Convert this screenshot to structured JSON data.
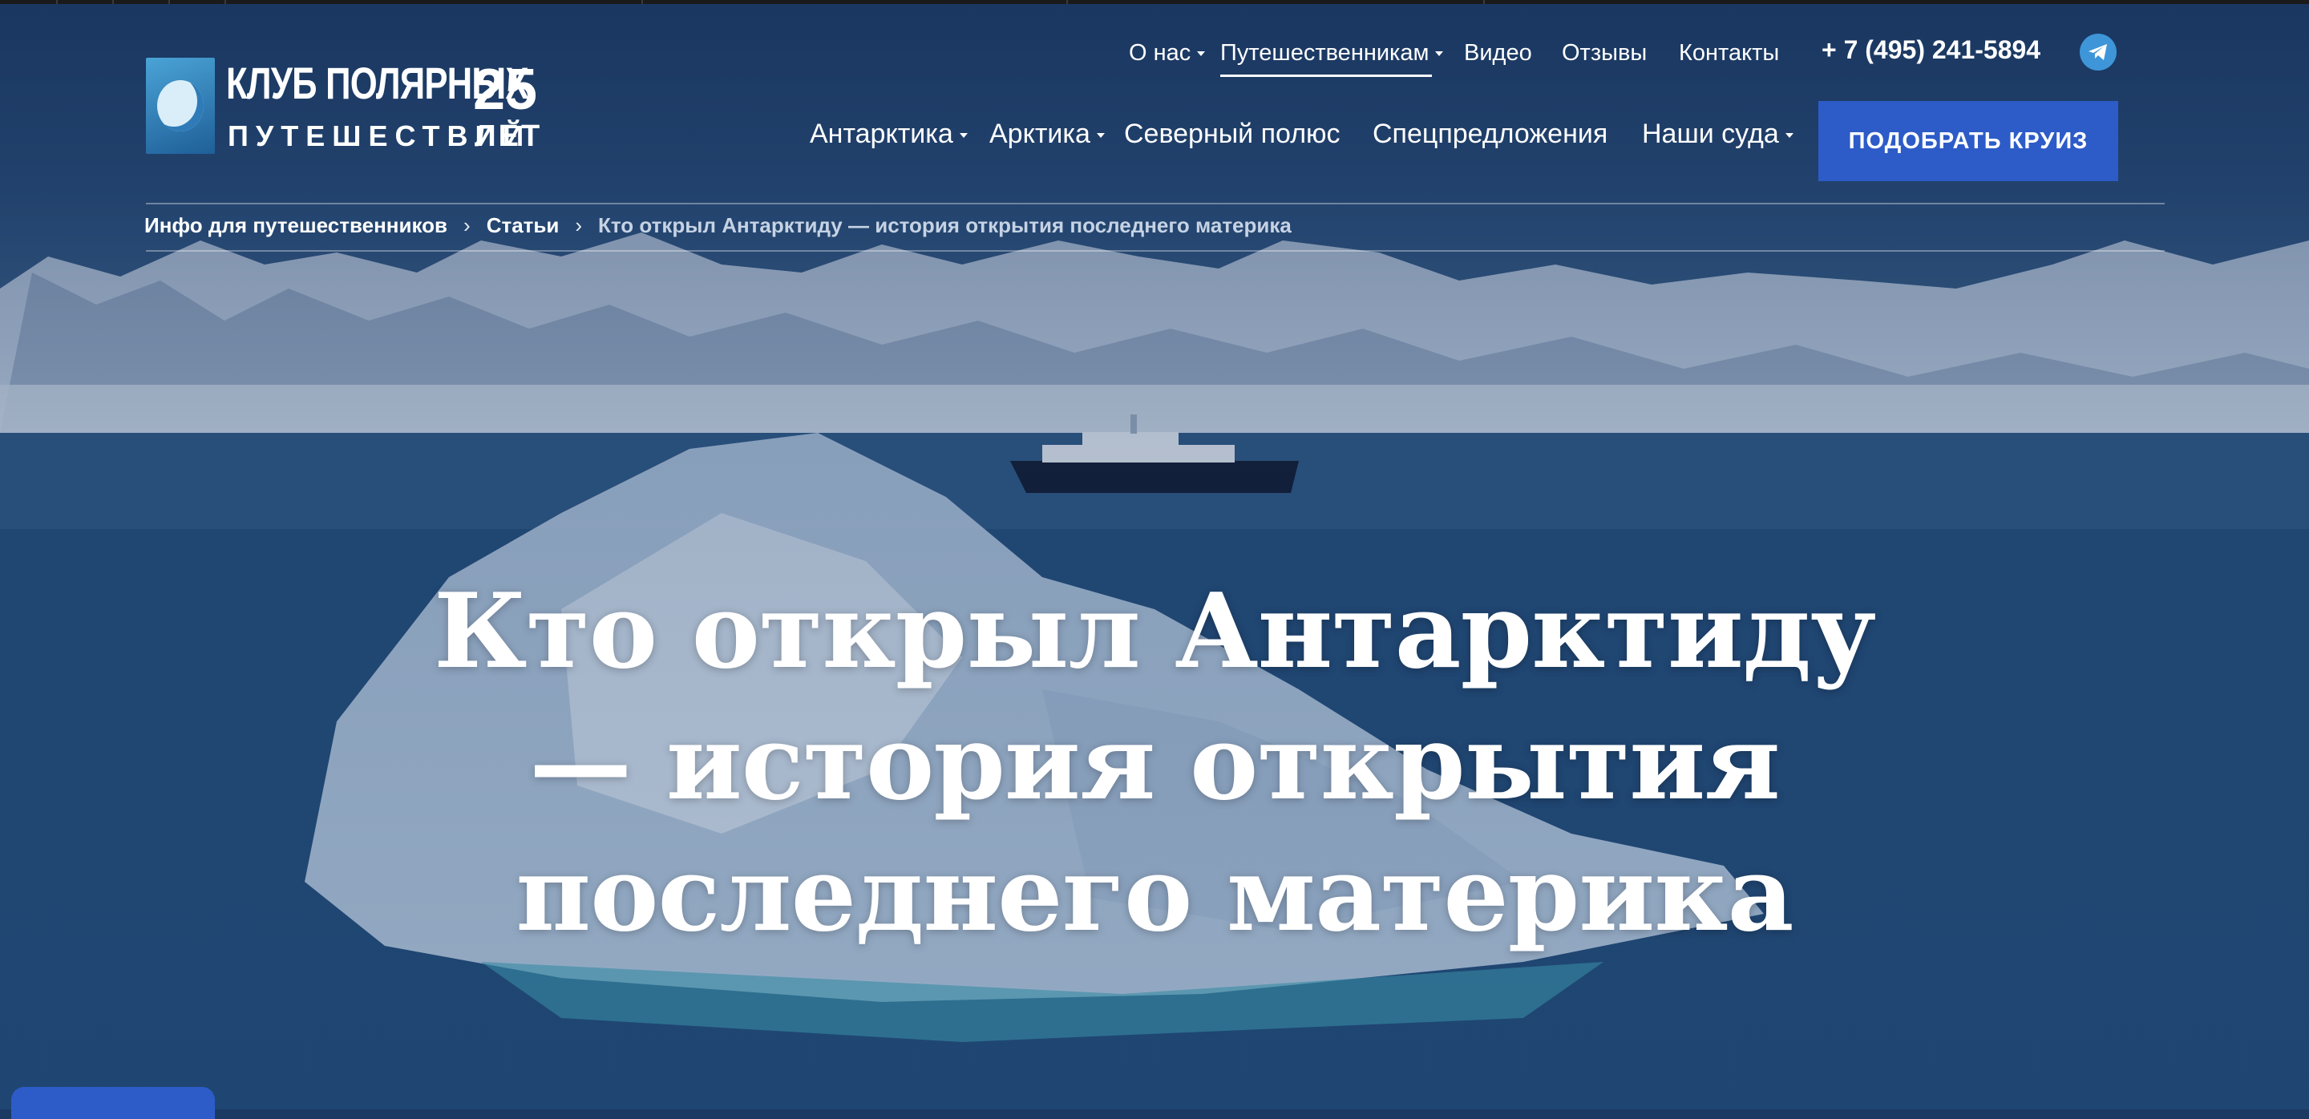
{
  "brand": {
    "logo_line1": "КЛУБ ПОЛЯРНЫХ",
    "logo_line2": "ПУТЕШЕСТВИЙ",
    "anniversary_number": "25",
    "anniversary_word": "ЛЕТ"
  },
  "nav_top": [
    {
      "label": "О нас",
      "dropdown": true
    },
    {
      "label": "Путешественникам",
      "dropdown": true,
      "active": true
    },
    {
      "label": "Видео",
      "dropdown": false
    },
    {
      "label": "Отзывы",
      "dropdown": false
    },
    {
      "label": "Контакты",
      "dropdown": false
    }
  ],
  "phone": "+ 7 (495) 241-5894",
  "telegram_icon": "telegram-icon",
  "nav_main": [
    {
      "label": "Антарктика",
      "dropdown": true
    },
    {
      "label": "Арктика",
      "dropdown": true
    },
    {
      "label": "Северный полюс",
      "dropdown": false
    },
    {
      "label": "Спецпредложения",
      "dropdown": false
    },
    {
      "label": "Наши суда",
      "dropdown": true
    }
  ],
  "cta_label": "ПОДОБРАТЬ КРУИЗ",
  "breadcrumb": {
    "items": [
      "Инфо для путешественников",
      "Статьи"
    ],
    "current": "Кто открыл Антарктиду — история открытия последнего материка",
    "separator": "›"
  },
  "hero": {
    "title_lines": [
      "Кто открыл Антарктиду",
      "— история открытия",
      "последнего материка"
    ]
  },
  "colors": {
    "accent": "#2d5cc8",
    "background": "#1b3a63",
    "telegram": "#3e96d8"
  }
}
